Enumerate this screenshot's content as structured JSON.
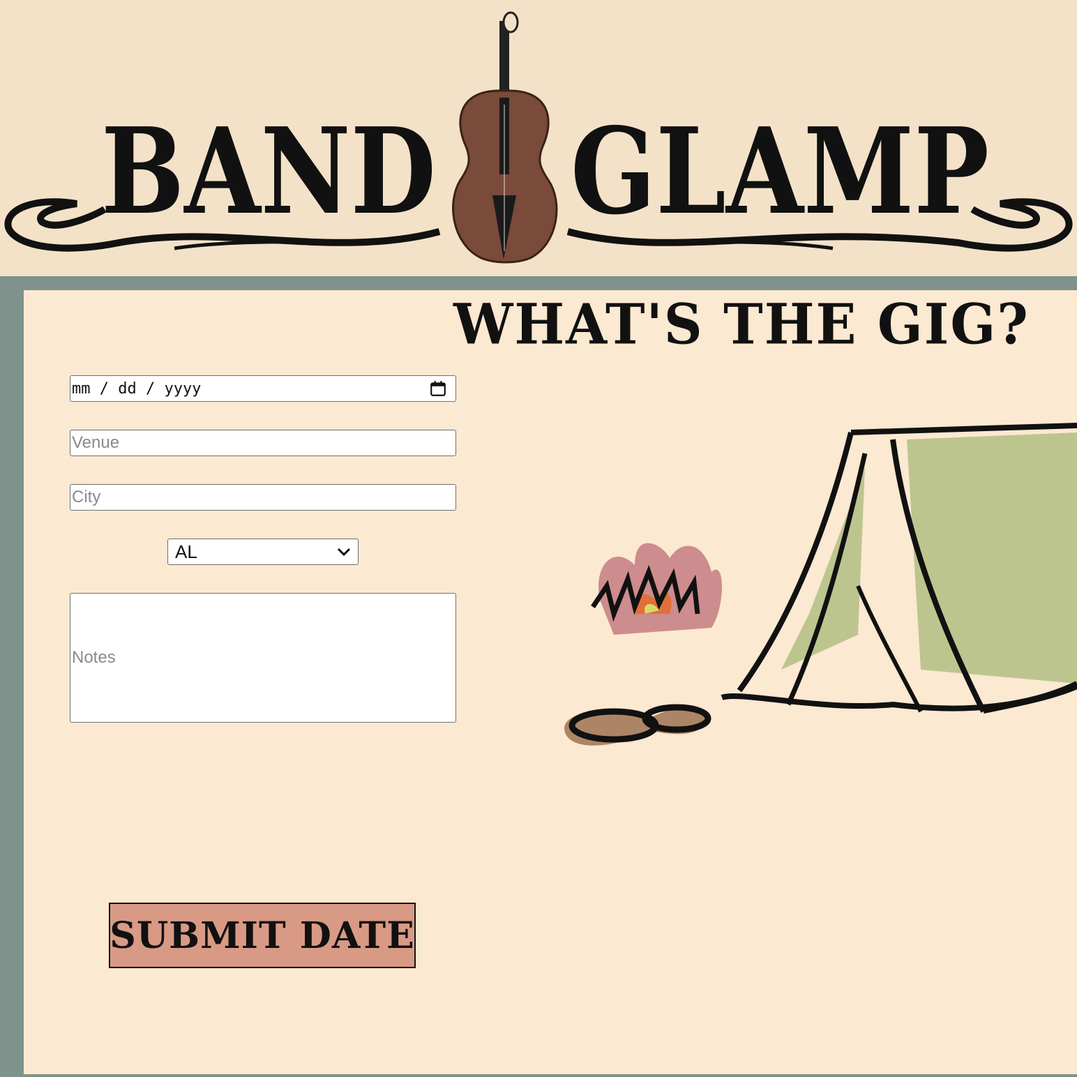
{
  "header": {
    "logo_left": "BAND",
    "logo_right": "GLAMP",
    "logo_icon": "violin-icon"
  },
  "form": {
    "heading": "WHAT'S THE GIG?",
    "date": {
      "placeholder": "mm / dd / yyyy",
      "icon": "calendar-icon"
    },
    "venue": {
      "placeholder": "Venue",
      "value": ""
    },
    "city": {
      "placeholder": "City",
      "value": ""
    },
    "state": {
      "selected": "AL"
    },
    "notes": {
      "placeholder": "Notes"
    },
    "submit_label": "SUBMIT DATE"
  },
  "illustration": {
    "icons": [
      "campfire-icon",
      "tent-icon"
    ]
  },
  "colors": {
    "banner_bg": "#f4e2c8",
    "panel_bg": "#fbe9d1",
    "frame": "#7f928b",
    "button_bg": "#d99a85",
    "violin": "#7a4a3a",
    "tent_green": "#8aa85a"
  }
}
